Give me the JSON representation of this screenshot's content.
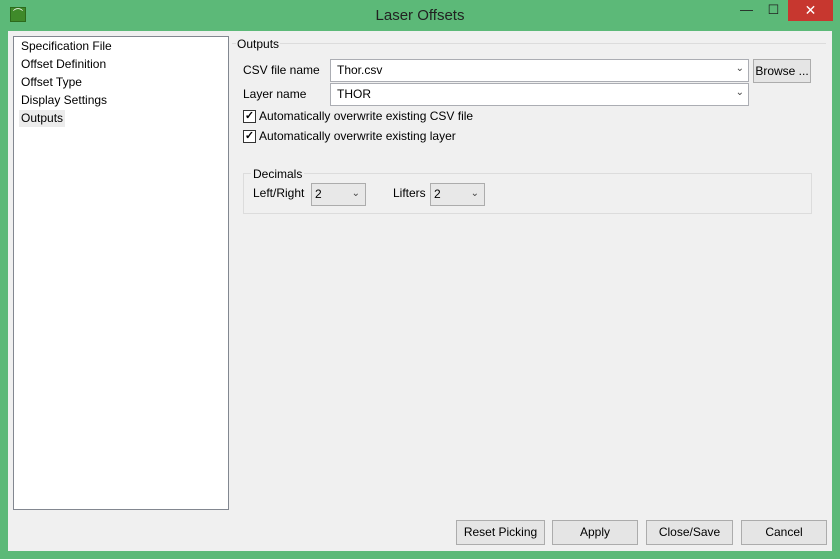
{
  "window": {
    "title": "Laser Offsets",
    "minimize": "—",
    "maximize": "☐",
    "close": "✕"
  },
  "sidebar": {
    "items": [
      {
        "label": "Specification File"
      },
      {
        "label": "Offset Definition"
      },
      {
        "label": "Offset Type"
      },
      {
        "label": "Display Settings"
      },
      {
        "label": "Outputs",
        "selected": true
      }
    ]
  },
  "outputs": {
    "group_title": "Outputs",
    "csv_label": "CSV file name",
    "csv_value": "Thor.csv",
    "browse_label": "Browse ...",
    "layer_label": "Layer name",
    "layer_value": "THOR",
    "overwrite_csv_label": "Automatically overwrite existing CSV file",
    "overwrite_csv_checked": true,
    "overwrite_layer_label": "Automatically overwrite existing layer",
    "overwrite_layer_checked": true
  },
  "decimals": {
    "group_title": "Decimals",
    "leftright_label": "Left/Right",
    "leftright_value": "2",
    "lifters_label": "Lifters",
    "lifters_value": "2"
  },
  "footer": {
    "reset_label": "Reset Picking",
    "apply_label": "Apply",
    "close_save_label": "Close/Save",
    "cancel_label": "Cancel"
  }
}
